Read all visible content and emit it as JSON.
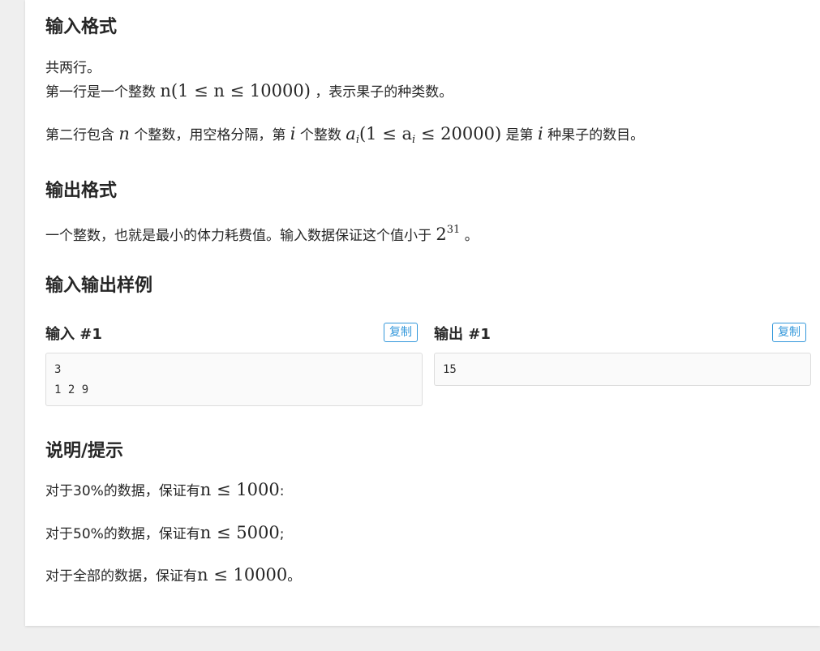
{
  "input_format": {
    "heading": "输入格式",
    "line1": "共两行。",
    "line2_pre": "第一行是一个整数",
    "line2_math": "n(1 ≤ n ≤ 10000)",
    "line2_post": "，表示果子的种类数。",
    "line3_a": "第二行包含",
    "line3_n": "n",
    "line3_b": "个整数，用空格分隔，第",
    "line3_i": "i",
    "line3_c": "个整数",
    "line3_math_a": "a",
    "line3_math_sub": "i",
    "line3_math_rest": "(1 ≤ a",
    "line3_math_sub2": "i",
    "line3_math_end": " ≤ 20000)",
    "line3_d": "是第",
    "line3_i2": "i",
    "line3_e": "种果子的数目。"
  },
  "output_format": {
    "heading": "输出格式",
    "text_pre": "一个整数，也就是最小的体力耗费值。输入数据保证这个值小于",
    "math_base": "2",
    "math_exp": "31",
    "text_post": "。"
  },
  "samples": {
    "heading": "输入输出样例",
    "input_title": "输入 #1",
    "output_title": "输出 #1",
    "copy_label": "复制",
    "input_lines": [
      "3",
      "1 2 9"
    ],
    "output_lines": [
      "15"
    ]
  },
  "hints": {
    "heading": "说明/提示",
    "line1_pre": "对于30%的数据，保证有",
    "line1_math": "n ≤ 1000",
    "line1_post": ":",
    "line2_pre": "对于50%的数据，保证有",
    "line2_math": "n ≤ 5000",
    "line2_post": ";",
    "line3_pre": "对于全部的数据，保证有",
    "line3_math": "n ≤ 10000",
    "line3_post": "。"
  }
}
